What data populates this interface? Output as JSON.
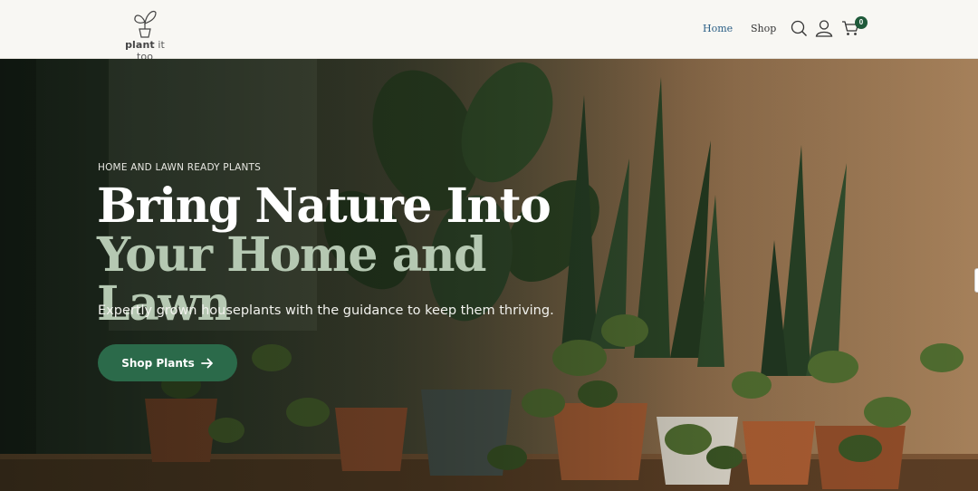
{
  "brand": {
    "logo_text_bold": "plant",
    "logo_text_rest": " it too",
    "icon": "plant-logo-icon"
  },
  "nav": {
    "items": [
      {
        "label": "Home",
        "active": true
      },
      {
        "label": "Shop",
        "active": false
      }
    ],
    "search_icon": "search-icon",
    "account_icon": "user-icon",
    "cart_icon": "cart-icon",
    "cart_count": "0"
  },
  "hero": {
    "eyebrow": "HOME AND LAWN READY PLANTS",
    "title_line1": "Bring Nature Into",
    "title_line2": "Your Home and Lawn",
    "subtitle": "Expertly grown houseplants with the guidance to keep them thriving.",
    "cta_label": "Shop Plants",
    "cta_icon": "arrow-right-icon"
  },
  "colors": {
    "accent": "#2b6a4a",
    "badge": "#1f5a3a",
    "title_secondary": "#b5c8b2",
    "nav_active": "#2b5f86"
  }
}
